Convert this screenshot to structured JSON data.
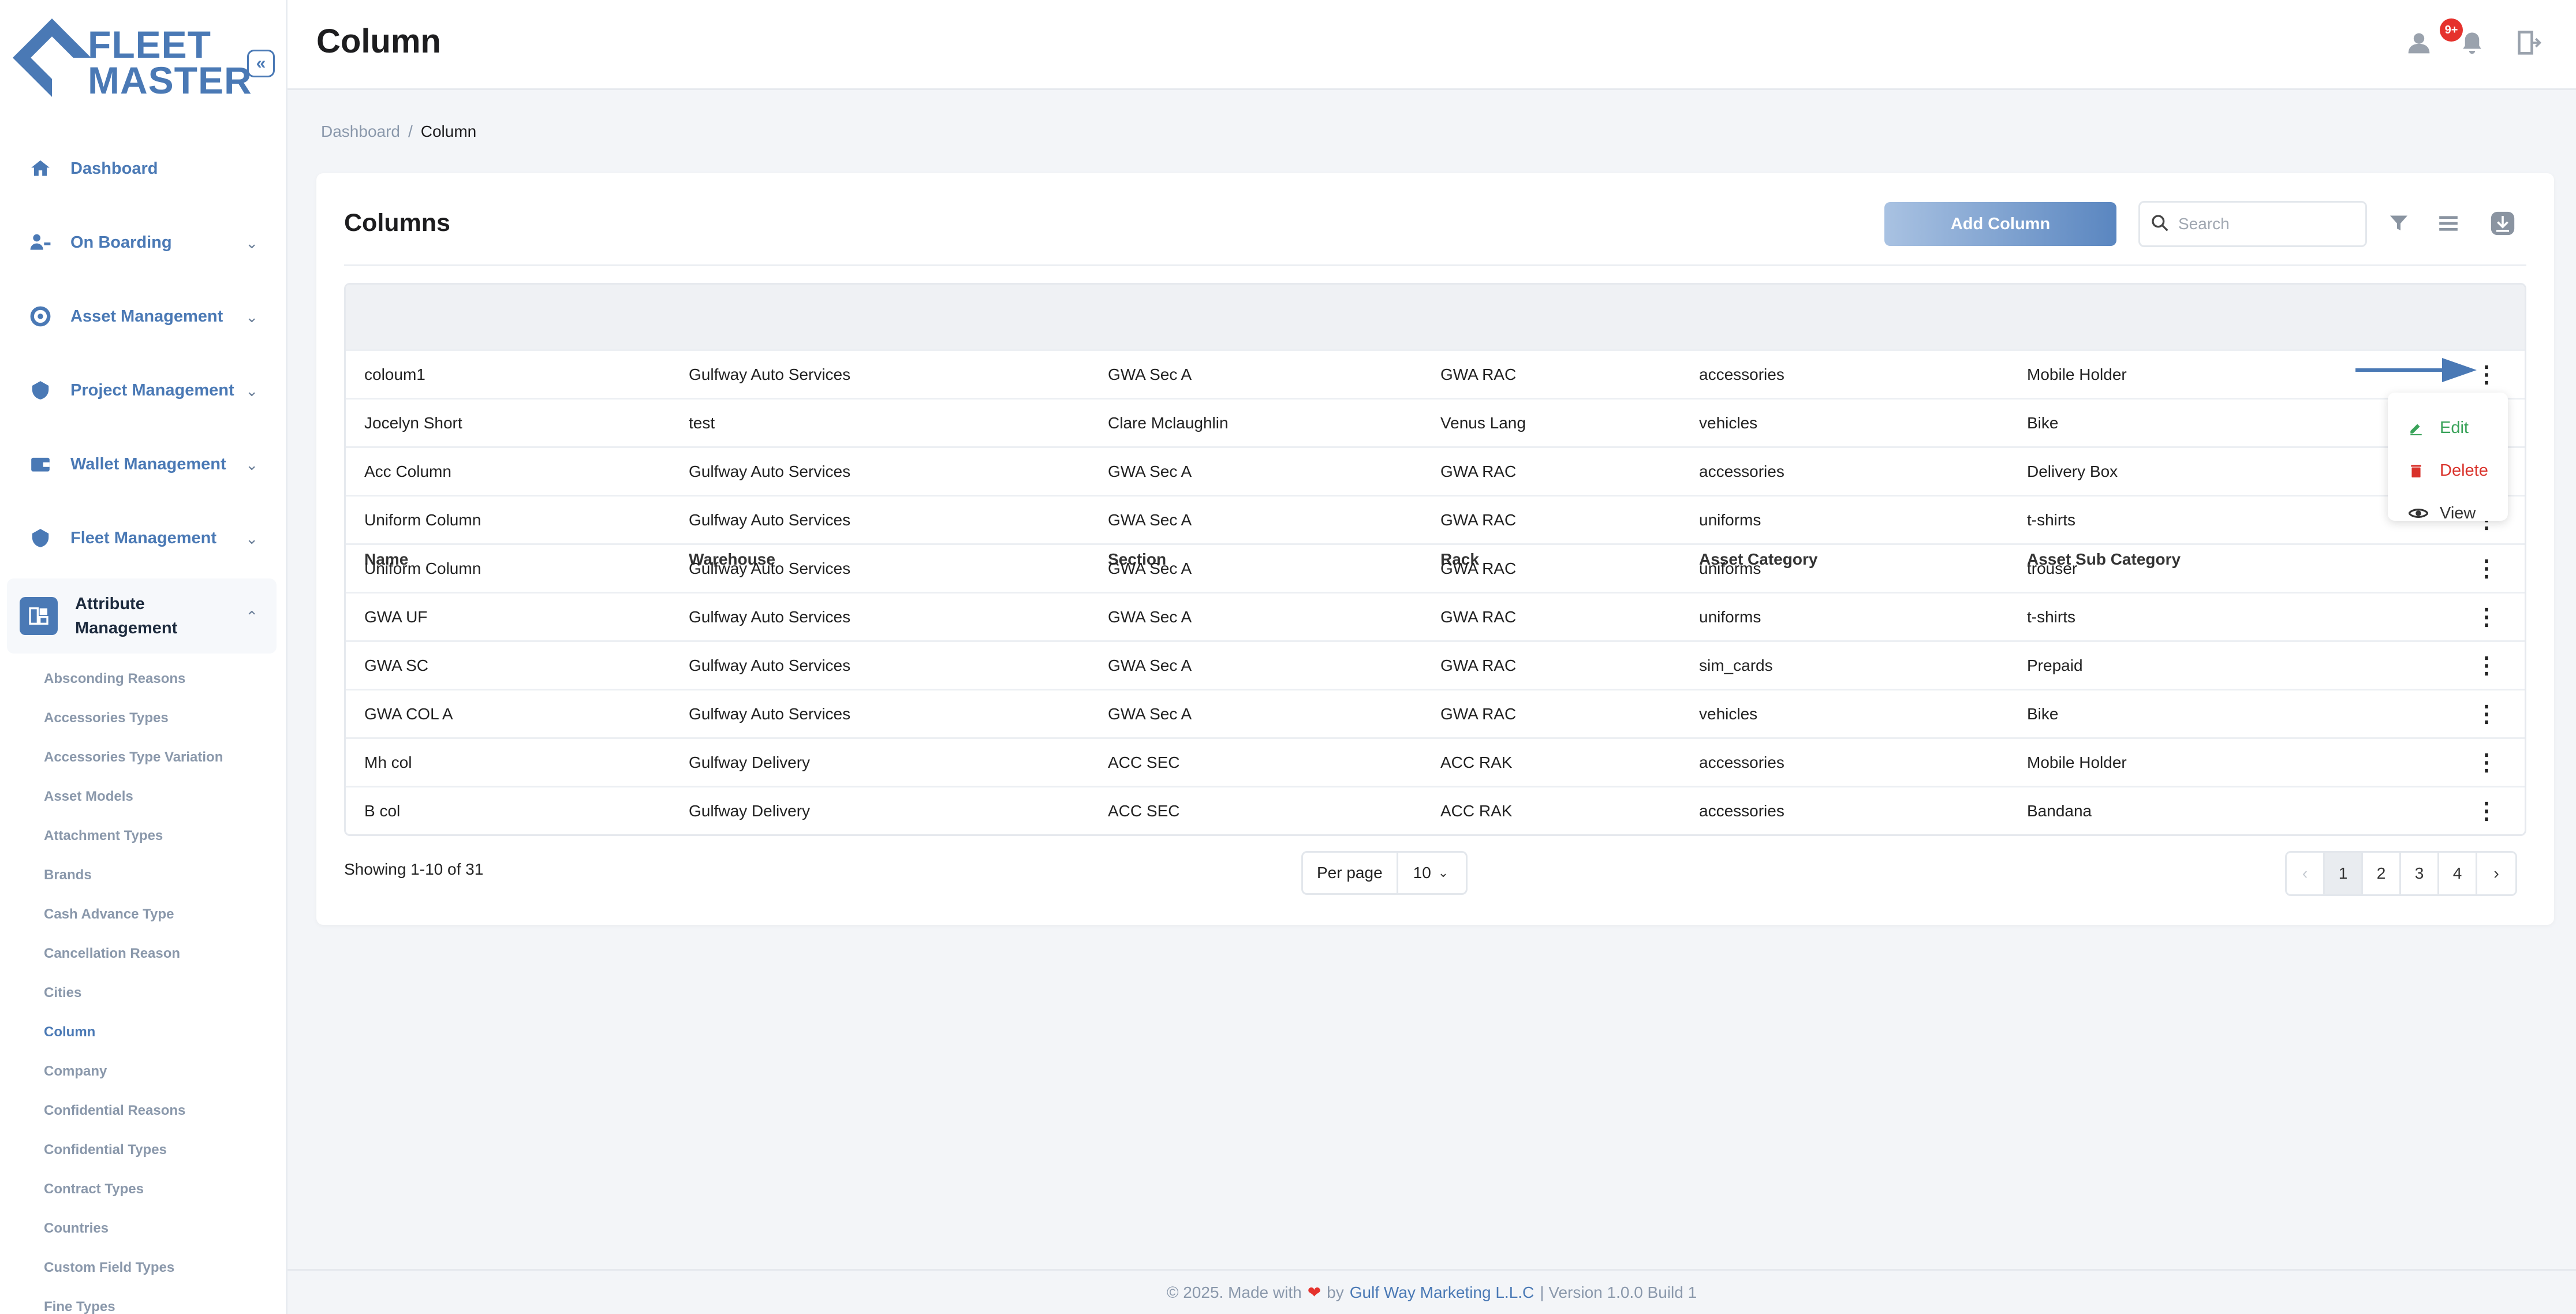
{
  "brand": {
    "line1": "FLEET",
    "line2": "MASTER"
  },
  "header": {
    "title": "Column",
    "notification_count": "9+"
  },
  "sidebar": {
    "items": [
      {
        "label": "Dashboard",
        "icon": "home-icon"
      },
      {
        "label": "On Boarding",
        "icon": "onboarding-icon"
      },
      {
        "label": "Asset Management",
        "icon": "asset-icon"
      },
      {
        "label": "Project Management",
        "icon": "project-icon"
      },
      {
        "label": "Wallet Management",
        "icon": "wallet-icon"
      },
      {
        "label": "Fleet Management",
        "icon": "fleet-icon"
      },
      {
        "label": "Attribute Management",
        "icon": "attribute-icon"
      }
    ],
    "sub_items": [
      "Absconding Reasons",
      "Accessories Types",
      "Accessories Type Variation",
      "Asset Models",
      "Attachment Types",
      "Brands",
      "Cash Advance Type",
      "Cancellation Reason",
      "Cities",
      "Column",
      "Company",
      "Confidential Reasons",
      "Confidential Types",
      "Contract Types",
      "Countries",
      "Custom Field Types",
      "Fine Types"
    ]
  },
  "breadcrumb": {
    "root": "Dashboard",
    "separator": "/",
    "current": "Column"
  },
  "card": {
    "title": "Columns",
    "add_button": "Add Column",
    "search_placeholder": "Search"
  },
  "table": {
    "headers": [
      "Name",
      "Warehouse",
      "Section",
      "Rack",
      "Asset Category",
      "Asset Sub Category"
    ],
    "rows": [
      [
        "coloum1",
        "Gulfway Auto Services",
        "GWA Sec A",
        "GWA RAC",
        "accessories",
        "Mobile Holder"
      ],
      [
        "Jocelyn Short",
        "test",
        "Clare Mclaughlin",
        "Venus Lang",
        "vehicles",
        "Bike"
      ],
      [
        "Acc Column",
        "Gulfway Auto Services",
        "GWA Sec A",
        "GWA RAC",
        "accessories",
        "Delivery Box"
      ],
      [
        "Uniform Column",
        "Gulfway Auto Services",
        "GWA Sec A",
        "GWA RAC",
        "uniforms",
        "t-shirts"
      ],
      [
        "Uniform Column",
        "Gulfway Auto Services",
        "GWA Sec A",
        "GWA RAC",
        "uniforms",
        "trouser"
      ],
      [
        "GWA UF",
        "Gulfway Auto Services",
        "GWA Sec A",
        "GWA RAC",
        "uniforms",
        "t-shirts"
      ],
      [
        "GWA SC",
        "Gulfway Auto Services",
        "GWA Sec A",
        "GWA RAC",
        "sim_cards",
        "Prepaid"
      ],
      [
        "GWA COL A",
        "Gulfway Auto Services",
        "GWA Sec A",
        "GWA RAC",
        "vehicles",
        "Bike"
      ],
      [
        "Mh col",
        "Gulfway Delivery",
        "ACC SEC",
        "ACC RAK",
        "accessories",
        "Mobile Holder"
      ],
      [
        "B col",
        "Gulfway Delivery",
        "ACC SEC",
        "ACC RAK",
        "accessories",
        "Bandana"
      ]
    ]
  },
  "row_menu": {
    "edit": "Edit",
    "delete": "Delete",
    "view": "View"
  },
  "pagination": {
    "showing": "Showing 1-10 of 31",
    "per_page_label": "Per page",
    "per_page_value": "10",
    "pages": [
      "1",
      "2",
      "3",
      "4"
    ],
    "current_page": "1"
  },
  "footer": {
    "prefix": "© 2025. Made with",
    "by": "by",
    "company": "Gulf Way Marketing L.L.C",
    "version": "| Version 1.0.0 Build 1"
  },
  "colors": {
    "accent": "#4a79b5",
    "danger": "#d9322b",
    "success": "#3aa35a"
  }
}
